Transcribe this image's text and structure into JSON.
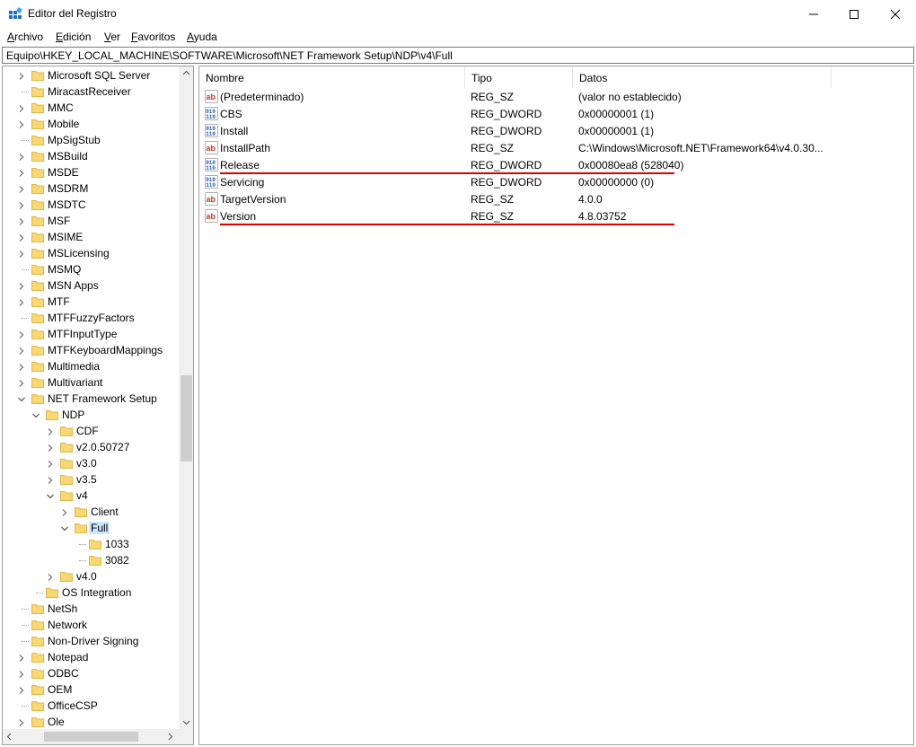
{
  "window": {
    "title": "Editor del Registro",
    "minimize_glyph": "—",
    "maximize_glyph": "☐",
    "close_glyph": "✕"
  },
  "menu": {
    "items": [
      {
        "mnemonic": "A",
        "rest": "rchivo"
      },
      {
        "mnemonic": "E",
        "rest": "dición"
      },
      {
        "mnemonic": "V",
        "rest": "er"
      },
      {
        "mnemonic": "F",
        "rest": "avoritos"
      },
      {
        "mnemonic": "A",
        "rest": "yuda"
      }
    ]
  },
  "address": {
    "path": "Equipo\\HKEY_LOCAL_MACHINE\\SOFTWARE\\Microsoft\\NET Framework Setup\\NDP\\v4\\Full"
  },
  "tree": {
    "nodes": [
      {
        "label": "Microsoft SQL Server",
        "level": 0,
        "expander": "collapsed"
      },
      {
        "label": "MiracastReceiver",
        "level": 0,
        "expander": "none"
      },
      {
        "label": "MMC",
        "level": 0,
        "expander": "collapsed"
      },
      {
        "label": "Mobile",
        "level": 0,
        "expander": "collapsed"
      },
      {
        "label": "MpSigStub",
        "level": 0,
        "expander": "none"
      },
      {
        "label": "MSBuild",
        "level": 0,
        "expander": "collapsed"
      },
      {
        "label": "MSDE",
        "level": 0,
        "expander": "collapsed"
      },
      {
        "label": "MSDRM",
        "level": 0,
        "expander": "collapsed"
      },
      {
        "label": "MSDTC",
        "level": 0,
        "expander": "collapsed"
      },
      {
        "label": "MSF",
        "level": 0,
        "expander": "collapsed"
      },
      {
        "label": "MSIME",
        "level": 0,
        "expander": "collapsed"
      },
      {
        "label": "MSLicensing",
        "level": 0,
        "expander": "collapsed"
      },
      {
        "label": "MSMQ",
        "level": 0,
        "expander": "none"
      },
      {
        "label": "MSN Apps",
        "level": 0,
        "expander": "collapsed"
      },
      {
        "label": "MTF",
        "level": 0,
        "expander": "collapsed"
      },
      {
        "label": "MTFFuzzyFactors",
        "level": 0,
        "expander": "none"
      },
      {
        "label": "MTFInputType",
        "level": 0,
        "expander": "collapsed"
      },
      {
        "label": "MTFKeyboardMappings",
        "level": 0,
        "expander": "collapsed"
      },
      {
        "label": "Multimedia",
        "level": 0,
        "expander": "collapsed"
      },
      {
        "label": "Multivariant",
        "level": 0,
        "expander": "collapsed"
      },
      {
        "label": "NET Framework Setup",
        "level": 0,
        "expander": "expanded"
      },
      {
        "label": "NDP",
        "level": 1,
        "expander": "expanded"
      },
      {
        "label": "CDF",
        "level": 2,
        "expander": "collapsed"
      },
      {
        "label": "v2.0.50727",
        "level": 2,
        "expander": "collapsed"
      },
      {
        "label": "v3.0",
        "level": 2,
        "expander": "collapsed"
      },
      {
        "label": "v3.5",
        "level": 2,
        "expander": "collapsed"
      },
      {
        "label": "v4",
        "level": 2,
        "expander": "expanded"
      },
      {
        "label": "Client",
        "level": 3,
        "expander": "collapsed"
      },
      {
        "label": "Full",
        "level": 3,
        "expander": "expanded",
        "selected": true
      },
      {
        "label": "1033",
        "level": 4,
        "expander": "none"
      },
      {
        "label": "3082",
        "level": 4,
        "expander": "none"
      },
      {
        "label": "v4.0",
        "level": 2,
        "expander": "collapsed"
      },
      {
        "label": "OS Integration",
        "level": 1,
        "expander": "none"
      },
      {
        "label": "NetSh",
        "level": 0,
        "expander": "none"
      },
      {
        "label": "Network",
        "level": 0,
        "expander": "none"
      },
      {
        "label": "Non-Driver Signing",
        "level": 0,
        "expander": "none"
      },
      {
        "label": "Notepad",
        "level": 0,
        "expander": "collapsed"
      },
      {
        "label": "ODBC",
        "level": 0,
        "expander": "collapsed"
      },
      {
        "label": "OEM",
        "level": 0,
        "expander": "collapsed"
      },
      {
        "label": "OfficeCSP",
        "level": 0,
        "expander": "none"
      },
      {
        "label": "Ole",
        "level": 0,
        "expander": "collapsed"
      }
    ]
  },
  "values_table": {
    "columns": [
      "Nombre",
      "Tipo",
      "Datos"
    ],
    "rows": [
      {
        "name": "(Predeterminado)",
        "type": "REG_SZ",
        "data": "(valor no establecido)",
        "icon": "string-value-icon",
        "underline": false
      },
      {
        "name": "CBS",
        "type": "REG_DWORD",
        "data": "0x00000001 (1)",
        "icon": "binary-value-icon",
        "underline": false
      },
      {
        "name": "Install",
        "type": "REG_DWORD",
        "data": "0x00000001 (1)",
        "icon": "binary-value-icon",
        "underline": false
      },
      {
        "name": "InstallPath",
        "type": "REG_SZ",
        "data": "C:\\Windows\\Microsoft.NET\\Framework64\\v4.0.30...",
        "icon": "string-value-icon",
        "underline": false
      },
      {
        "name": "Release",
        "type": "REG_DWORD",
        "data": "0x00080ea8 (528040)",
        "icon": "binary-value-icon",
        "underline": true
      },
      {
        "name": "Servicing",
        "type": "REG_DWORD",
        "data": "0x00000000 (0)",
        "icon": "binary-value-icon",
        "underline": false
      },
      {
        "name": "TargetVersion",
        "type": "REG_SZ",
        "data": "4.0.0",
        "icon": "string-value-icon",
        "underline": false
      },
      {
        "name": "Version",
        "type": "REG_SZ",
        "data": "4.8.03752",
        "icon": "string-value-icon",
        "underline": true
      }
    ]
  },
  "colors": {
    "folder": "#f8d775",
    "folder_dark": "#e0b84a",
    "selection": "#cce8ff",
    "annotation_red": "#e00000",
    "dword_icon": "#1e5aa8",
    "string_icon": "#c0392b"
  }
}
